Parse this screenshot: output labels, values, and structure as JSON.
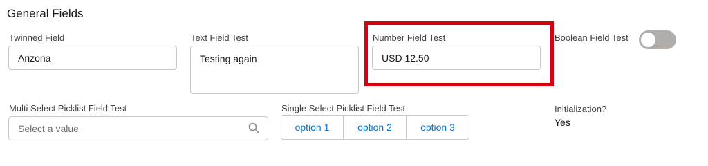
{
  "section": {
    "title": "General Fields"
  },
  "twinned": {
    "label": "Twinned Field",
    "value": "Arizona"
  },
  "text_field": {
    "label": "Text Field Test",
    "value": "Testing again"
  },
  "number_field": {
    "label": "Number Field Test",
    "value": "USD 12.50"
  },
  "boolean_field": {
    "label": "Boolean Field Test",
    "checked": false
  },
  "multi_select": {
    "label": "Multi Select Picklist Field Test",
    "placeholder": "Select a value",
    "icon": "search-icon"
  },
  "single_select": {
    "label": "Single Select Picklist Field Test",
    "options": [
      "option 1",
      "option 2",
      "option 3"
    ]
  },
  "initialization": {
    "label": "Initialization?",
    "value": "Yes"
  },
  "colors": {
    "highlight": "#d7000f",
    "link": "#0b70c9",
    "toggle_off": "#b0adab"
  }
}
